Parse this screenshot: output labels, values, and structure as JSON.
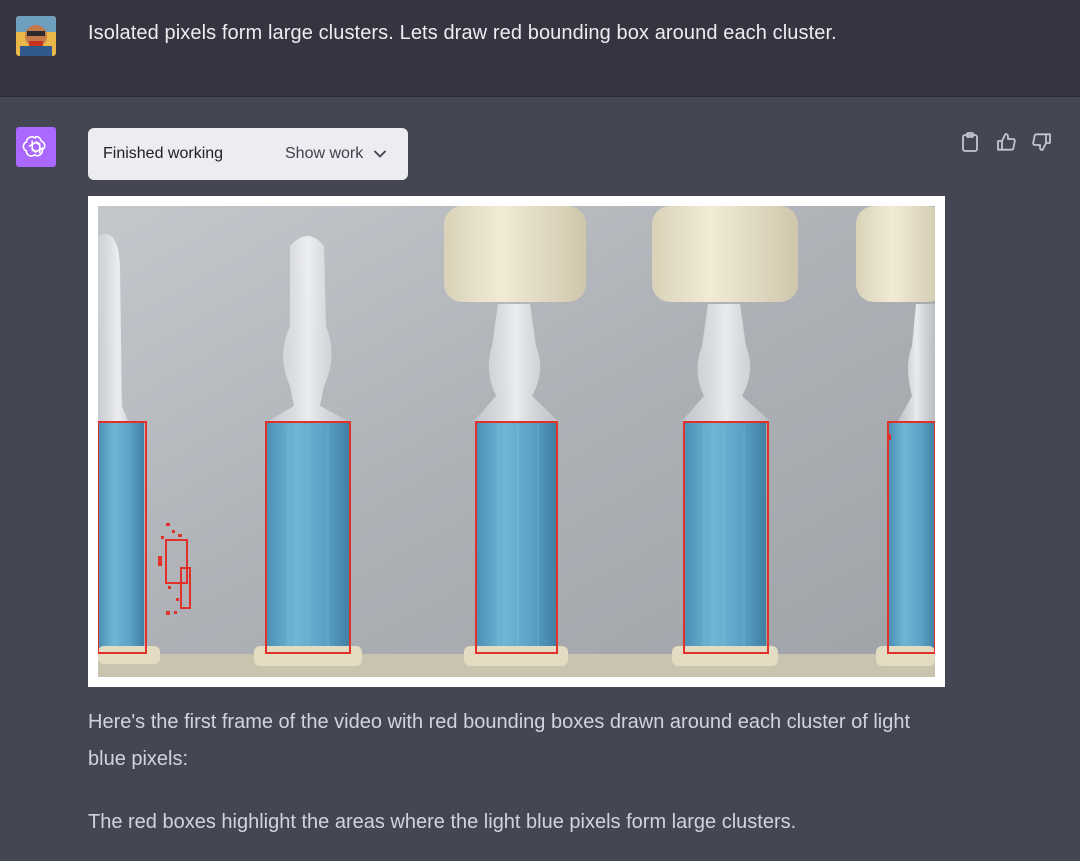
{
  "user_message": {
    "text": "Isolated pixels form large clusters. Lets draw red bounding box around each cluster."
  },
  "assistant": {
    "status": {
      "label": "Finished working",
      "toggle_label": "Show work"
    },
    "actions": {
      "copy_icon": "clipboard-icon",
      "like_icon": "thumbs-up-icon",
      "dislike_icon": "thumbs-down-icon"
    },
    "paragraphs": [
      "Here's the first frame of the video with red bounding boxes drawn around each cluster of light blue pixels:",
      "The red boxes highlight the areas where the light blue pixels form large clusters."
    ]
  },
  "colors": {
    "user_bg": "#343541",
    "assistant_bg": "#444654",
    "assistant_avatar": "#ab68ff",
    "bounding_box": "#e0312b",
    "liquid": "#5aa3c5"
  }
}
